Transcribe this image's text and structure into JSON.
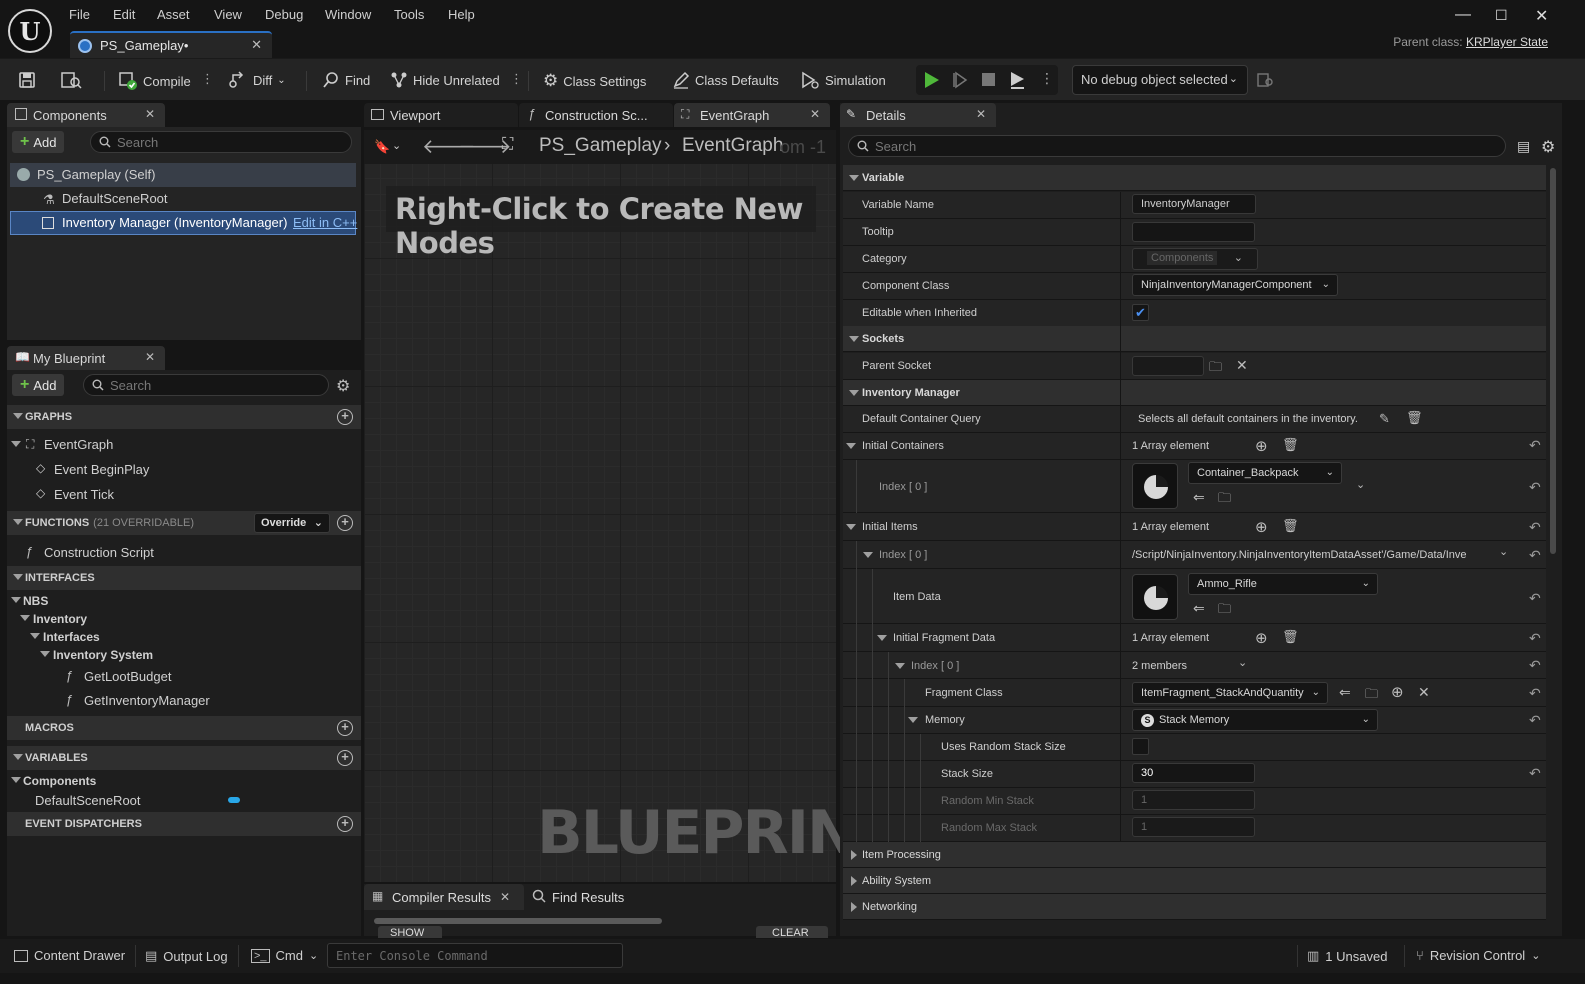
{
  "menu": [
    "File",
    "Edit",
    "Asset",
    "View",
    "Debug",
    "Window",
    "Tools",
    "Help"
  ],
  "document_tab": "PS_Gameplay•",
  "parent_class": {
    "label": "Parent class:",
    "value": "KRPlayer State"
  },
  "toolbar": {
    "compile": "Compile",
    "diff": "Diff",
    "find": "Find",
    "hide_unrelated": "Hide Unrelated",
    "class_settings": "Class Settings",
    "class_defaults": "Class Defaults",
    "simulation": "Simulation",
    "debug_object": "No debug object selected"
  },
  "components": {
    "tab": "Components",
    "add": "Add",
    "search_placeholder": "Search",
    "items": [
      "PS_Gameplay (Self)",
      "DefaultSceneRoot",
      "Inventory Manager (InventoryManager)"
    ],
    "edit_in_cpp": "Edit in C++"
  },
  "my_blueprint": {
    "tab": "My Blueprint",
    "add": "Add",
    "search_placeholder": "Search",
    "graphs_header": "GRAPHS",
    "graphs": [
      "EventGraph",
      "Event BeginPlay",
      "Event Tick"
    ],
    "functions_header": "FUNCTIONS",
    "functions_count": "(21 OVERRIDABLE)",
    "override": "Override",
    "functions": [
      "Construction Script"
    ],
    "interfaces_header": "INTERFACES",
    "interfaces_tree": [
      "NBS",
      "Inventory",
      "Interfaces",
      "Inventory System",
      "GetLootBudget",
      "GetInventoryManager"
    ],
    "macros_header": "MACROS",
    "variables_header": "VARIABLES",
    "variables_group": "Components",
    "variables": [
      "DefaultSceneRoot"
    ],
    "dispatchers_header": "EVENT DISPATCHERS"
  },
  "graph_tabs": [
    "Viewport",
    "Construction Sc...",
    "EventGraph"
  ],
  "graph": {
    "breadcrumb_root": "PS_Gameplay",
    "breadcrumb_leaf": "EventGraph",
    "zoom": "om -1",
    "hint": "Right-Click to Create New Nodes",
    "watermark": "BLUEPRINT"
  },
  "bottom_tabs": {
    "compiler": "Compiler Results",
    "find": "Find Results",
    "show": "SHOW",
    "clear": "CLEAR"
  },
  "details": {
    "tab": "Details",
    "search_placeholder": "Search",
    "sections": {
      "variable": "Variable",
      "sockets": "Sockets",
      "inventory_manager": "Inventory Manager",
      "item_processing": "Item Processing",
      "ability_system": "Ability System",
      "networking": "Networking"
    },
    "variable_name": {
      "label": "Variable Name",
      "value": "InventoryManager"
    },
    "tooltip": {
      "label": "Tooltip",
      "value": ""
    },
    "category": {
      "label": "Category",
      "value": "Components"
    },
    "component_class": {
      "label": "Component Class",
      "value": "NinjaInventoryManagerComponent"
    },
    "editable_inherited": {
      "label": "Editable when Inherited",
      "checked": true
    },
    "parent_socket": {
      "label": "Parent Socket",
      "value": ""
    },
    "default_container_query": {
      "label": "Default Container Query",
      "value": "Selects all default containers in the inventory."
    },
    "initial_containers": {
      "label": "Initial Containers",
      "value": "1 Array element",
      "index": "Index [ 0 ]",
      "asset": "Container_Backpack"
    },
    "initial_items": {
      "label": "Initial Items",
      "value": "1 Array element",
      "index": "Index [ 0 ]",
      "path": "/Script/NinjaInventory.NinjaInventoryItemDataAsset'/Game/Data/Inve"
    },
    "item_data": {
      "label": "Item Data",
      "asset": "Ammo_Rifle"
    },
    "initial_fragment_data": {
      "label": "Initial Fragment Data",
      "value": "1 Array element",
      "index": "Index [ 0 ]",
      "members": "2 members"
    },
    "fragment_class": {
      "label": "Fragment Class",
      "value": "ItemFragment_StackAndQuantity"
    },
    "memory": {
      "label": "Memory",
      "value": "Stack Memory"
    },
    "uses_random_stack": {
      "label": "Uses Random Stack Size",
      "checked": false
    },
    "stack_size": {
      "label": "Stack Size",
      "value": "30"
    },
    "random_min_stack": {
      "label": "Random Min Stack",
      "value": "1"
    },
    "random_max_stack": {
      "label": "Random Max Stack",
      "value": "1"
    }
  },
  "statusbar": {
    "content_drawer": "Content Drawer",
    "output_log": "Output Log",
    "cmd": "Cmd",
    "console_placeholder": "Enter Console Command",
    "unsaved": "1 Unsaved",
    "revision_control": "Revision Control"
  },
  "colors": {
    "accent_blue": "#2a70c4",
    "add_green": "#6fc34a",
    "play_green": "#4fb83a",
    "selection": "#3a4a64",
    "variable_pill": "#29a7e8"
  }
}
